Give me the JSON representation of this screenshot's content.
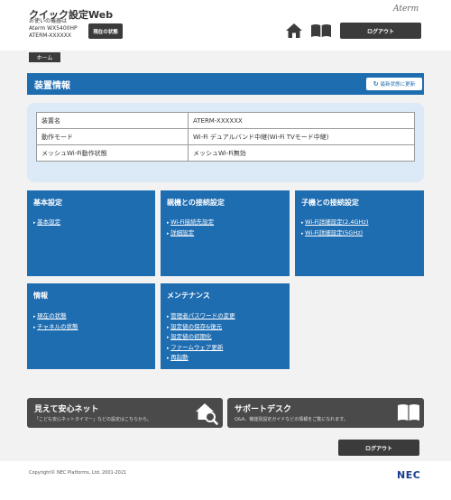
{
  "header": {
    "app_title": "クイック設定Web",
    "device_line1": "お使いの機器は",
    "device_line2": "Aterm WX5400HP",
    "device_line3": "ATERM-XXXXXX",
    "status_button": "現在の状態",
    "brand": "Aterm",
    "logout": "ログアウト"
  },
  "breadcrumb": {
    "home": "ホーム"
  },
  "section": {
    "title": "装置情報",
    "refresh": "最新状態に更新"
  },
  "device_table": [
    {
      "key": "装置名",
      "value": "ATERM-XXXXXX"
    },
    {
      "key": "動作モード",
      "value": "Wi-Fi デュアルバンド中継(Wi-Fi TVモード中継)"
    },
    {
      "key": "メッシュWi-Fi動作状態",
      "value": "メッシュWi-Fi無効"
    }
  ],
  "cards": [
    {
      "title": "基本設定",
      "links": [
        "基本設定"
      ]
    },
    {
      "title": "親機との接続設定",
      "links": [
        "Wi-Fi接続先設定",
        "詳細設定"
      ]
    },
    {
      "title": "子機との接続設定",
      "links": [
        "Wi-Fi詳細設定(2.4GHz)",
        "Wi-Fi詳細設定(5GHz)"
      ]
    },
    {
      "title": "情報",
      "links": [
        "現在の状態",
        "チャネルの状態"
      ]
    },
    {
      "title": "メンテナンス",
      "links": [
        "管理者パスワードの変更",
        "設定値の保存&復元",
        "設定値の初期化",
        "ファームウェア更新",
        "再起動"
      ]
    }
  ],
  "banners": [
    {
      "title": "見えて安心ネット",
      "subtitle": "「こども安心ネットタイマー」などの設定はこちらから。",
      "icon": "home-search-icon"
    },
    {
      "title": "サポートデスク",
      "subtitle": "Q&A、機能別設定ガイドなどの情報をご覧になれます。",
      "icon": "book-icon"
    }
  ],
  "footer": {
    "copyright": "Copyright© NEC Platforms, Ltd. 2001-2021",
    "logo": "NEC",
    "logout": "ログアウト"
  },
  "colors": {
    "primary": "#1f6db1",
    "dark_button": "#3b3b3b",
    "info_bg": "#dceaf7",
    "banner": "#4a4a4a"
  }
}
